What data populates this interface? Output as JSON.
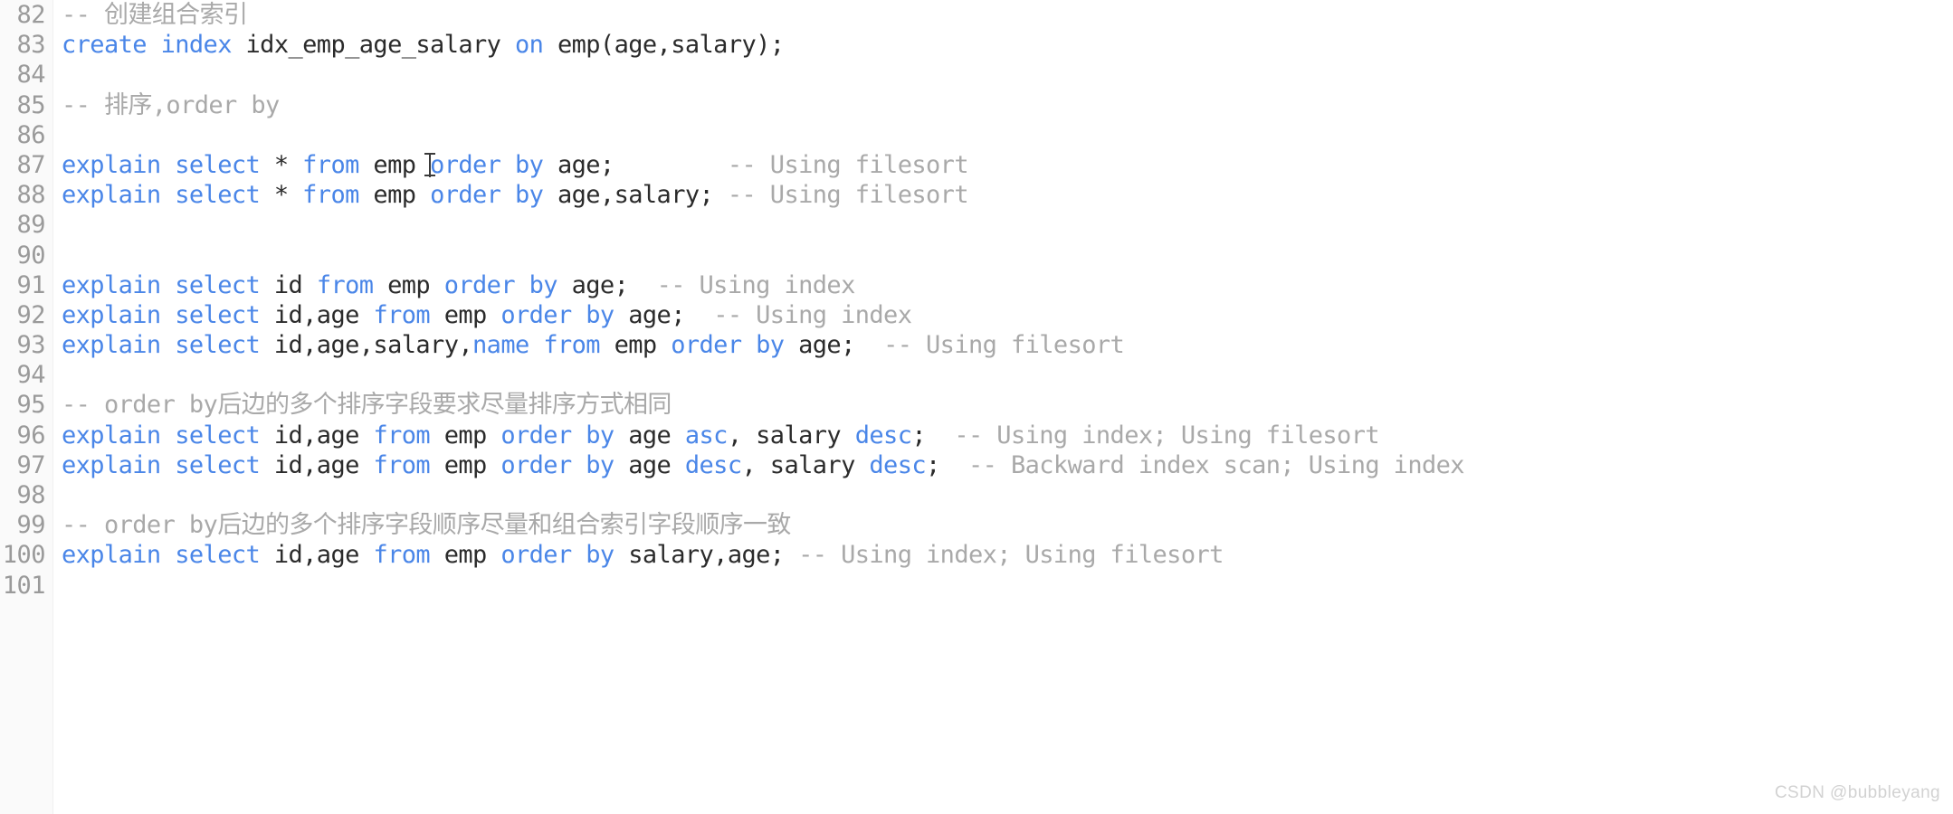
{
  "editor": {
    "first_line_number": 82,
    "language": "sql",
    "colors": {
      "background": "#ffffff",
      "gutter_background": "#fafafa",
      "line_number": "#9a9a9a",
      "keyword": "#4a86e8",
      "identifier": "#2b2b2b",
      "comment": "#a9a9a9"
    },
    "lines": [
      {
        "number": "82",
        "tokens": [
          {
            "t": "-- 创建组合索引",
            "k": "cmt"
          }
        ]
      },
      {
        "number": "83",
        "tokens": [
          {
            "t": "create",
            "k": "kw"
          },
          {
            "t": " ",
            "k": "id"
          },
          {
            "t": "index",
            "k": "kw"
          },
          {
            "t": " idx_emp_age_salary ",
            "k": "id"
          },
          {
            "t": "on",
            "k": "kw"
          },
          {
            "t": " emp(age,salary);",
            "k": "id"
          }
        ]
      },
      {
        "number": "84",
        "tokens": []
      },
      {
        "number": "85",
        "tokens": [
          {
            "t": "-- 排序,order by",
            "k": "cmt"
          }
        ]
      },
      {
        "number": "86",
        "tokens": []
      },
      {
        "number": "87",
        "tokens": [
          {
            "t": "explain",
            "k": "kw"
          },
          {
            "t": " ",
            "k": "id"
          },
          {
            "t": "select",
            "k": "kw"
          },
          {
            "t": " * ",
            "k": "id"
          },
          {
            "t": "from",
            "k": "kw"
          },
          {
            "t": " emp ",
            "k": "id"
          },
          {
            "t": "order",
            "k": "kw"
          },
          {
            "t": " ",
            "k": "id"
          },
          {
            "t": "by",
            "k": "kw"
          },
          {
            "t": " age;        ",
            "k": "id"
          },
          {
            "t": "-- Using filesort",
            "k": "cmt"
          }
        ],
        "caret_after_token": 5
      },
      {
        "number": "88",
        "tokens": [
          {
            "t": "explain",
            "k": "kw"
          },
          {
            "t": " ",
            "k": "id"
          },
          {
            "t": "select",
            "k": "kw"
          },
          {
            "t": " * ",
            "k": "id"
          },
          {
            "t": "from",
            "k": "kw"
          },
          {
            "t": " emp ",
            "k": "id"
          },
          {
            "t": "order",
            "k": "kw"
          },
          {
            "t": " ",
            "k": "id"
          },
          {
            "t": "by",
            "k": "kw"
          },
          {
            "t": " age,salary; ",
            "k": "id"
          },
          {
            "t": "-- Using filesort",
            "k": "cmt"
          }
        ]
      },
      {
        "number": "89",
        "tokens": []
      },
      {
        "number": "90",
        "tokens": []
      },
      {
        "number": "91",
        "tokens": [
          {
            "t": "explain",
            "k": "kw"
          },
          {
            "t": " ",
            "k": "id"
          },
          {
            "t": "select",
            "k": "kw"
          },
          {
            "t": " id ",
            "k": "id"
          },
          {
            "t": "from",
            "k": "kw"
          },
          {
            "t": " emp ",
            "k": "id"
          },
          {
            "t": "order",
            "k": "kw"
          },
          {
            "t": " ",
            "k": "id"
          },
          {
            "t": "by",
            "k": "kw"
          },
          {
            "t": " age;  ",
            "k": "id"
          },
          {
            "t": "-- Using index",
            "k": "cmt"
          }
        ]
      },
      {
        "number": "92",
        "tokens": [
          {
            "t": "explain",
            "k": "kw"
          },
          {
            "t": " ",
            "k": "id"
          },
          {
            "t": "select",
            "k": "kw"
          },
          {
            "t": " id,age ",
            "k": "id"
          },
          {
            "t": "from",
            "k": "kw"
          },
          {
            "t": " emp ",
            "k": "id"
          },
          {
            "t": "order",
            "k": "kw"
          },
          {
            "t": " ",
            "k": "id"
          },
          {
            "t": "by",
            "k": "kw"
          },
          {
            "t": " age;  ",
            "k": "id"
          },
          {
            "t": "-- Using index",
            "k": "cmt"
          }
        ]
      },
      {
        "number": "93",
        "tokens": [
          {
            "t": "explain",
            "k": "kw"
          },
          {
            "t": " ",
            "k": "id"
          },
          {
            "t": "select",
            "k": "kw"
          },
          {
            "t": " id,age,salary,",
            "k": "id"
          },
          {
            "t": "name",
            "k": "kw"
          },
          {
            "t": " ",
            "k": "id"
          },
          {
            "t": "from",
            "k": "kw"
          },
          {
            "t": " emp ",
            "k": "id"
          },
          {
            "t": "order",
            "k": "kw"
          },
          {
            "t": " ",
            "k": "id"
          },
          {
            "t": "by",
            "k": "kw"
          },
          {
            "t": " age;  ",
            "k": "id"
          },
          {
            "t": "-- Using filesort",
            "k": "cmt"
          }
        ]
      },
      {
        "number": "94",
        "tokens": []
      },
      {
        "number": "95",
        "tokens": [
          {
            "t": "-- order by后边的多个排序字段要求尽量排序方式相同",
            "k": "cmt"
          }
        ]
      },
      {
        "number": "96",
        "tokens": [
          {
            "t": "explain",
            "k": "kw"
          },
          {
            "t": " ",
            "k": "id"
          },
          {
            "t": "select",
            "k": "kw"
          },
          {
            "t": " id,age ",
            "k": "id"
          },
          {
            "t": "from",
            "k": "kw"
          },
          {
            "t": " emp ",
            "k": "id"
          },
          {
            "t": "order",
            "k": "kw"
          },
          {
            "t": " ",
            "k": "id"
          },
          {
            "t": "by",
            "k": "kw"
          },
          {
            "t": " age ",
            "k": "id"
          },
          {
            "t": "asc",
            "k": "kw"
          },
          {
            "t": ", salary ",
            "k": "id"
          },
          {
            "t": "desc",
            "k": "kw"
          },
          {
            "t": ";  ",
            "k": "id"
          },
          {
            "t": "-- Using index; Using filesort",
            "k": "cmt"
          }
        ]
      },
      {
        "number": "97",
        "tokens": [
          {
            "t": "explain",
            "k": "kw"
          },
          {
            "t": " ",
            "k": "id"
          },
          {
            "t": "select",
            "k": "kw"
          },
          {
            "t": " id,age ",
            "k": "id"
          },
          {
            "t": "from",
            "k": "kw"
          },
          {
            "t": " emp ",
            "k": "id"
          },
          {
            "t": "order",
            "k": "kw"
          },
          {
            "t": " ",
            "k": "id"
          },
          {
            "t": "by",
            "k": "kw"
          },
          {
            "t": " age ",
            "k": "id"
          },
          {
            "t": "desc",
            "k": "kw"
          },
          {
            "t": ", salary ",
            "k": "id"
          },
          {
            "t": "desc",
            "k": "kw"
          },
          {
            "t": ";  ",
            "k": "id"
          },
          {
            "t": "-- Backward index scan; Using index",
            "k": "cmt"
          }
        ]
      },
      {
        "number": "98",
        "tokens": []
      },
      {
        "number": "99",
        "tokens": [
          {
            "t": "-- order by后边的多个排序字段顺序尽量和组合索引字段顺序一致",
            "k": "cmt"
          }
        ]
      },
      {
        "number": "100",
        "tokens": [
          {
            "t": "explain",
            "k": "kw"
          },
          {
            "t": " ",
            "k": "id"
          },
          {
            "t": "select",
            "k": "kw"
          },
          {
            "t": " id,age ",
            "k": "id"
          },
          {
            "t": "from",
            "k": "kw"
          },
          {
            "t": " emp ",
            "k": "id"
          },
          {
            "t": "order",
            "k": "kw"
          },
          {
            "t": " ",
            "k": "id"
          },
          {
            "t": "by",
            "k": "kw"
          },
          {
            "t": " salary,age; ",
            "k": "id"
          },
          {
            "t": "-- Using index; Using filesort",
            "k": "cmt"
          }
        ]
      },
      {
        "number": "101",
        "tokens": []
      }
    ]
  },
  "watermark": {
    "text": "CSDN @bubbleyang"
  }
}
